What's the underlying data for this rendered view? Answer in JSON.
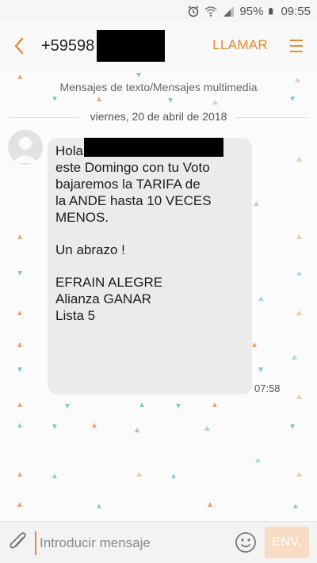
{
  "status_bar": {
    "battery": "95%",
    "time": "09:55",
    "icons": [
      "alarm-icon",
      "wifi-icon",
      "signal-icon",
      "battery-icon"
    ]
  },
  "app_bar": {
    "contact_number": "+59598",
    "call_label": "LLAMAR",
    "icons": [
      "back-arrow-icon",
      "menu-icon"
    ],
    "accent_color": "#e8892c"
  },
  "thread": {
    "label": "Mensajes de texto/Mensajes multimedia",
    "date": "viernes, 20 de abril de 2018"
  },
  "message": {
    "lines_1": "Hola\neste Domingo con tu Voto\nbajaremos la TARIFA de\nla ANDE hasta 10 VECES\nMENOS.",
    "lines_2": "Un abrazo !",
    "lines_3": "EFRAIN ALEGRE\nAlianza GANAR\nLista 5",
    "time": "07:58"
  },
  "composer": {
    "placeholder": "Introducir mensaje",
    "send_label": "ENV.",
    "icons": [
      "paperclip-icon",
      "emoji-icon"
    ]
  }
}
